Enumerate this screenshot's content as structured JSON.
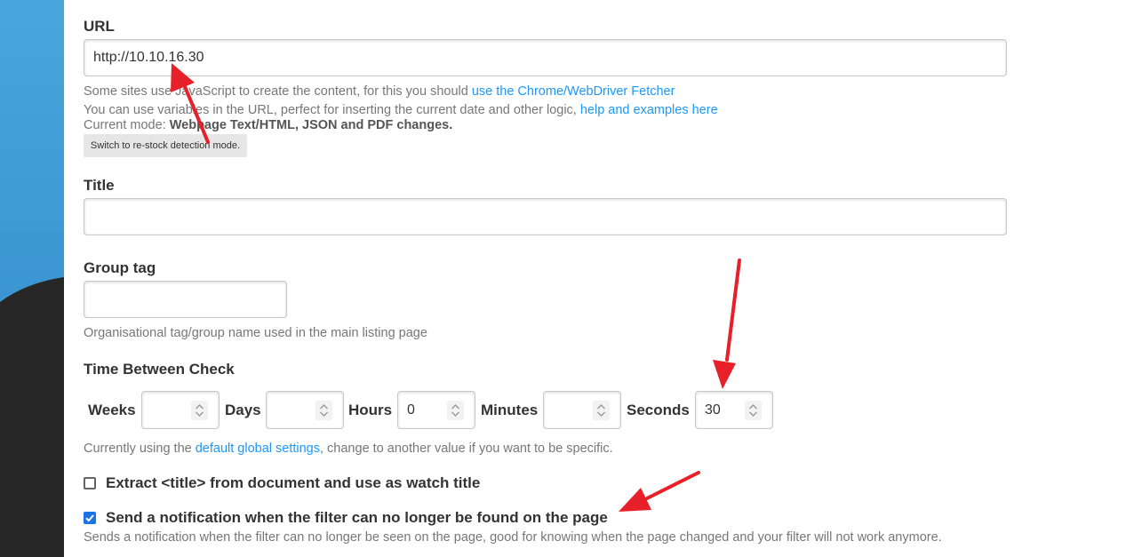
{
  "url_section": {
    "label": "URL",
    "value": "http://10.10.16.30",
    "help1_text": "Some sites use JavaScript to create the content, for this you should ",
    "help1_link": "use the Chrome/WebDriver Fetcher",
    "help2_text": "You can use variables in the URL, perfect for inserting the current date and other logic, ",
    "help2_link": "help and examples here",
    "mode_prefix": "Current mode: ",
    "mode_value": "Webpage Text/HTML, JSON and PDF changes.",
    "switch_button": "Switch to re-stock detection mode."
  },
  "title_section": {
    "label": "Title",
    "value": ""
  },
  "group_section": {
    "label": "Group tag",
    "value": "",
    "help": "Organisational tag/group name used in the main listing page"
  },
  "time_section": {
    "label": "Time Between Check",
    "weeks_label": "Weeks",
    "weeks_value": "",
    "days_label": "Days",
    "days_value": "",
    "hours_label": "Hours",
    "hours_value": "0",
    "minutes_label": "Minutes",
    "minutes_value": "",
    "seconds_label": "Seconds",
    "seconds_value": "30",
    "help_prefix": "Currently using the ",
    "help_link": "default global settings",
    "help_suffix": ", change to another value if you want to be specific."
  },
  "checkboxes": {
    "extract_title": {
      "label": "Extract <title> from document and use as watch title",
      "checked": false
    },
    "filter_notify": {
      "label": "Send a notification when the filter can no longer be found on the page",
      "checked": true,
      "help": "Sends a notification when the filter can no longer be seen on the page, good for knowing when the page changed and your filter will not work anymore."
    }
  },
  "colors": {
    "link": "#1b98f8",
    "sidebar_blue": "#3a9ad8",
    "sidebar_dark": "#262626",
    "checkbox": "#1a73e8",
    "annotation_arrow": "#e8202a"
  },
  "icons": [
    "spinner-arrows-icon",
    "checkmark-icon",
    "annotation-arrow"
  ]
}
